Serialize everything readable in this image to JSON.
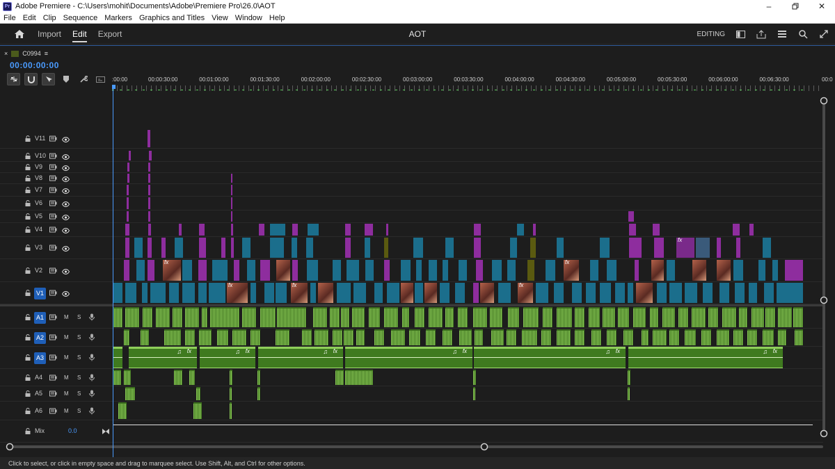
{
  "window": {
    "title": "Adobe Premiere - C:\\Users\\mohit\\Documents\\Adobe\\Premiere Pro\\26.0\\AOT",
    "logo": "Pr",
    "controls": [
      "minimize-icon",
      "restore-icon",
      "close-icon"
    ]
  },
  "menu": [
    "File",
    "Edit",
    "Clip",
    "Sequence",
    "Markers",
    "Graphics and Titles",
    "View",
    "Window",
    "Help"
  ],
  "workspace": {
    "tabs": [
      {
        "label": "Import",
        "active": false
      },
      {
        "label": "Edit",
        "active": true
      },
      {
        "label": "Export",
        "active": false
      }
    ],
    "project_name": "AOT",
    "mode_label": "EDITING",
    "icons": [
      "panel-icon",
      "share-icon",
      "workspaces-icon",
      "search-help-icon",
      "fullscreen-icon"
    ]
  },
  "sequence": {
    "name": "C0994",
    "timecode": "00:00:00:00",
    "accent": "#4a9bff",
    "ruler_labels": [
      ":00:00",
      "00:00:30:00",
      "00:01:00:00",
      "00:01:30:00",
      "00:02:00:00",
      "00:02:30:00",
      "00:03:00:00",
      "00:03:30:00",
      "00:04:00:00",
      "00:04:30:00",
      "00:05:00:00",
      "00:05:30:00",
      "00:06:00:00",
      "00:06:30:00",
      "00:0"
    ]
  },
  "tracks": {
    "video": [
      "V11",
      "V10",
      "V9",
      "V8",
      "V7",
      "V6",
      "V5",
      "V4",
      "V3",
      "V2",
      "V1"
    ],
    "audio": [
      "A1",
      "A2",
      "A3",
      "A4",
      "A5",
      "A6"
    ],
    "targeted": [
      "V1",
      "A1",
      "A2",
      "A3"
    ],
    "mute_label": "M",
    "solo_label": "S",
    "mix_label": "Mix",
    "mix_value": "0.0",
    "fx_label": "fx",
    "colors": {
      "purple": "#8e2d9e",
      "teal": "#1b6e8c",
      "olive": "#5a5a10",
      "audio_green": "#3c6e1e",
      "audio_light": "#8fcf5a"
    }
  },
  "status": "Click to select, or click in empty space and drag to marquee select. Use Shift, Alt, and Ctrl for other options."
}
